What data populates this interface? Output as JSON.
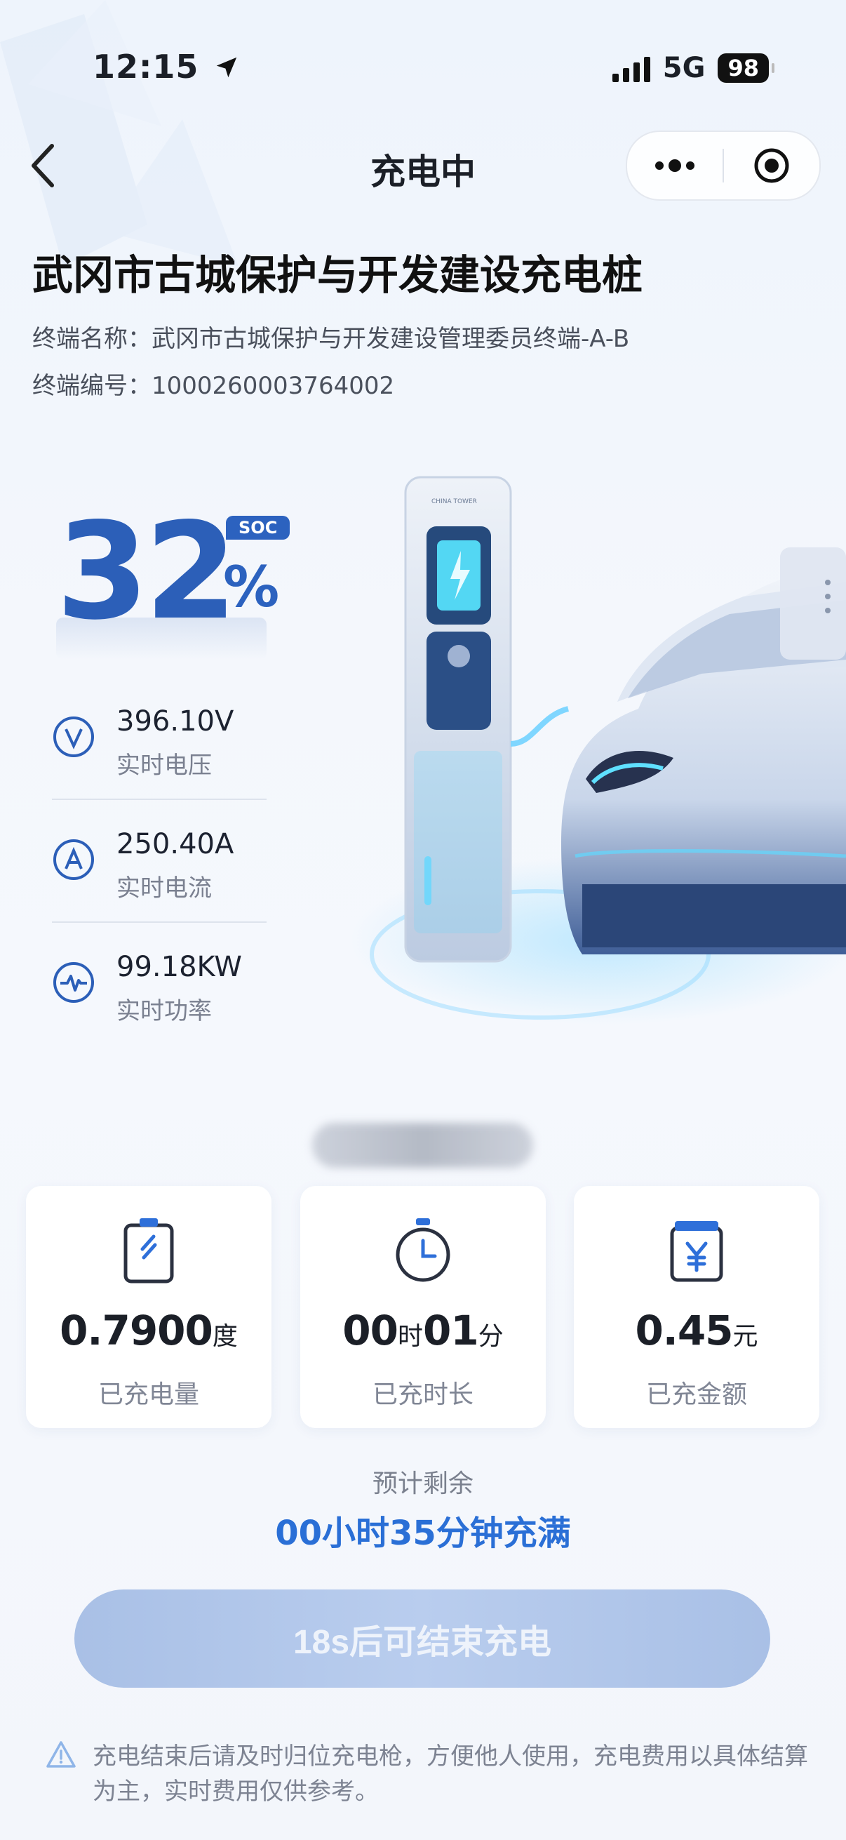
{
  "status_bar": {
    "time": "12:15",
    "network": "5G",
    "battery": "98"
  },
  "nav": {
    "title": "充电中"
  },
  "station": {
    "title": "武冈市古城保护与开发建设充电桩",
    "terminal_name_label": "终端名称：",
    "terminal_name": "武冈市古城保护与开发建设管理委员终端-A-B",
    "terminal_no_label": "终端编号：",
    "terminal_no": "1000260003764002"
  },
  "soc": {
    "value": "32",
    "unit": "%",
    "badge": "SOC",
    "percent": 32
  },
  "metrics": [
    {
      "value": "396.10V",
      "label": "实时电压",
      "icon": "voltage-icon"
    },
    {
      "value": "250.40A",
      "label": "实时电流",
      "icon": "current-icon"
    },
    {
      "value": "99.18KW",
      "label": "实时功率",
      "icon": "power-icon"
    }
  ],
  "charger_brand": "CHINA TOWER",
  "stats": [
    {
      "value": "0.7900",
      "unit": "度",
      "label": "已充电量",
      "icon": "battery-charge-icon"
    },
    {
      "value_h": "00",
      "unit_h": "时",
      "value_m": "01",
      "unit_m": "分",
      "label": "已充时长",
      "icon": "clock-icon"
    },
    {
      "value": "0.45",
      "unit": "元",
      "label": "已充金额",
      "icon": "yuan-icon"
    }
  ],
  "remaining": {
    "label": "预计剩余",
    "value": "00小时35分钟充满"
  },
  "end_button": {
    "label": "18s后可结束充电"
  },
  "notice": {
    "text": "充电结束后请及时归位充电枪，方便他人使用，充电费用以具体结算为主，实时费用仅供参考。",
    "icon": "warning-icon"
  },
  "colors": {
    "accent": "#2a6fd6",
    "soc": "#2c5fb8",
    "button": "#b3c7ea"
  }
}
